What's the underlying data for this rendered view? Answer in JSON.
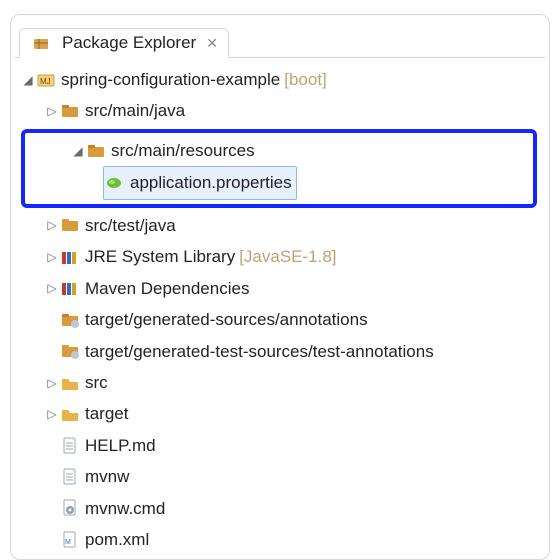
{
  "tab": {
    "title": "Package Explorer"
  },
  "project": {
    "name": "spring-configuration-example",
    "decoration": "[boot]"
  },
  "nodes": {
    "src_main_java": "src/main/java",
    "src_main_resources": "src/main/resources",
    "application_properties": "application.properties",
    "src_test_java": "src/test/java",
    "jre": {
      "label": "JRE System Library",
      "deco": "[JavaSE-1.8]"
    },
    "maven": "Maven Dependencies",
    "gen_src": "target/generated-sources/annotations",
    "gen_test": "target/generated-test-sources/test-annotations",
    "src_folder": "src",
    "target_folder": "target",
    "help": "HELP.md",
    "mvnw": "mvnw",
    "mvnw_cmd": "mvnw.cmd",
    "pom": "pom.xml"
  }
}
